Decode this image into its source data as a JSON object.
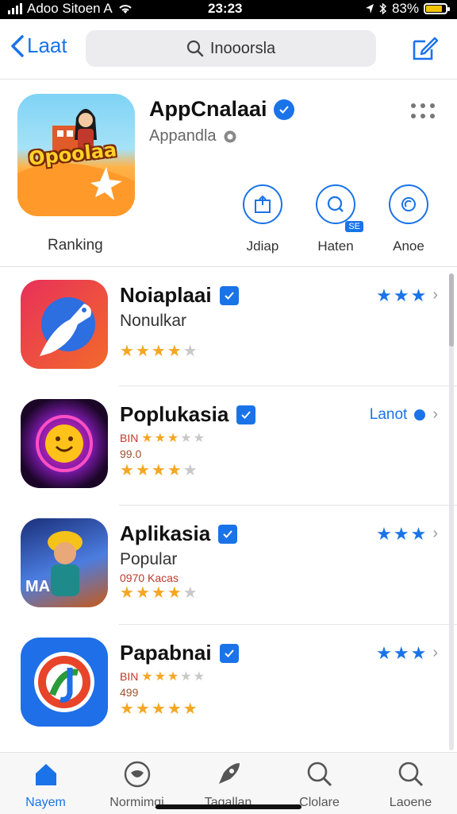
{
  "status_bar": {
    "carrier": "Adoo Sitoen A",
    "time": "23:23",
    "battery": "83%",
    "battery_level": 0.83
  },
  "nav": {
    "back_label": "Laat",
    "search_text": "Inooorsla"
  },
  "featured": {
    "title": "AppCnalaai",
    "subtitle": "Appandla",
    "icon_text": "Opoolaa",
    "ranking_label": "Ranking",
    "actions": [
      {
        "label": "Jdiap",
        "icon": "share-box-icon"
      },
      {
        "label": "Haten",
        "icon": "search-circle-icon",
        "badge": "SE"
      },
      {
        "label": "Anoe",
        "icon": "circle-target-icon"
      }
    ]
  },
  "apps": [
    {
      "name": "Noiaplaai",
      "subtitle": "Nonulkar",
      "meta_line1": "",
      "meta_line2": "",
      "stars": 3.5,
      "right_text": "",
      "right_stars": 3,
      "icon": "bird-icon",
      "icon_colors": [
        "#e8305a",
        "#f26a2a"
      ]
    },
    {
      "name": "Poplukasia",
      "subtitle": "",
      "meta_line1": "BIN",
      "meta_line2": "99.0",
      "meta_stars": 3,
      "stars": 3.5,
      "right_text": "Lanot",
      "right_stars": 0,
      "icon": "smiley-icon",
      "icon_colors": [
        "#2b0a3d",
        "#ff2ea6"
      ]
    },
    {
      "name": "Aplikasia",
      "subtitle": "Popular",
      "meta_line1": "0970 Kacas",
      "meta_line2": "",
      "stars": 3.5,
      "right_text": "",
      "right_stars": 3,
      "icon": "character-icon",
      "icon_colors": [
        "#2a3d8f",
        "#f0a030"
      ]
    },
    {
      "name": "Papabnai",
      "subtitle": "",
      "meta_line1": "BIN",
      "meta_line2": "499",
      "meta_stars": 3,
      "stars": 5,
      "right_text": "",
      "right_stars": 3,
      "icon": "ring-logo-icon",
      "icon_colors": [
        "#1e6fe8",
        "#ffffff"
      ]
    }
  ],
  "tabs": [
    {
      "label": "Nayem",
      "icon": "home-icon",
      "active": true
    },
    {
      "label": "Normimgi",
      "icon": "smile-circle-icon",
      "active": false
    },
    {
      "label": "Tagallan",
      "icon": "rocket-icon",
      "active": false
    },
    {
      "label": "Clolare",
      "icon": "search-icon",
      "active": false
    },
    {
      "label": "Laoene",
      "icon": "search-icon",
      "active": false
    }
  ],
  "colors": {
    "accent": "#1a73e8",
    "star": "#f5a623"
  }
}
